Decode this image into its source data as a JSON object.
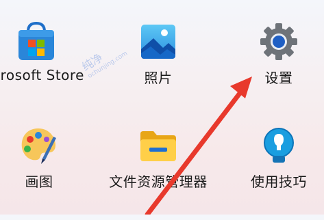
{
  "apps": [
    {
      "id": "store",
      "label": "icrosoft Store",
      "icon": "microsoft-store-icon"
    },
    {
      "id": "photos",
      "label": "照片",
      "icon": "photos-icon"
    },
    {
      "id": "settings",
      "label": "设置",
      "icon": "settings-gear-icon"
    },
    {
      "id": "paint",
      "label": "画图",
      "icon": "paint-palette-icon"
    },
    {
      "id": "explorer",
      "label": "文件资源管理器",
      "icon": "file-explorer-folder-icon"
    },
    {
      "id": "tips",
      "label": "使用技巧",
      "icon": "tips-lightbulb-icon"
    }
  ],
  "annotation": {
    "type": "arrow",
    "color": "#e8392c",
    "points_to": "settings"
  },
  "watermark": {
    "text": "纯净",
    "subtext": "ochunjing.com"
  }
}
